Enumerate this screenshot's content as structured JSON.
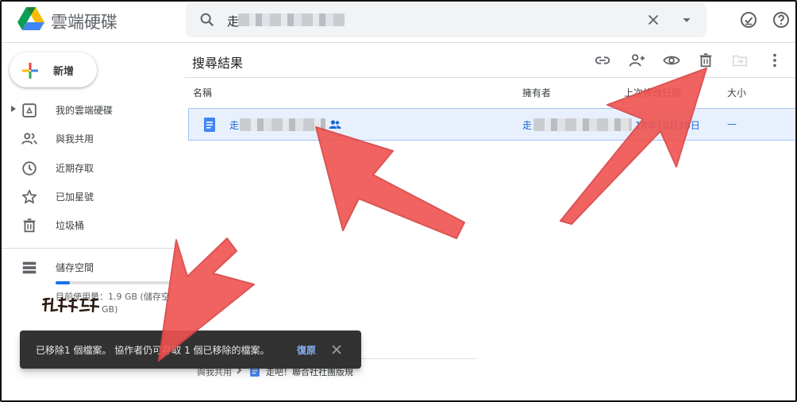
{
  "app": {
    "title": "雲端硬碟"
  },
  "search": {
    "query_visible": "走"
  },
  "new_button": {
    "label": "新增"
  },
  "sidebar": {
    "items": [
      {
        "label": "我的雲端硬碟",
        "icon": "my-drive-icon"
      },
      {
        "label": "與我共用",
        "icon": "shared-with-me-icon"
      },
      {
        "label": "近期存取",
        "icon": "recent-icon"
      },
      {
        "label": "已加星號",
        "icon": "star-icon"
      },
      {
        "label": "垃圾桶",
        "icon": "trash-icon"
      }
    ],
    "storage": {
      "label": "儲存空間",
      "usage_text": "目前使用量：1.9 GB (儲存空",
      "usage_text_line2": "GB)",
      "used_fraction": 0.12
    }
  },
  "main": {
    "title": "搜尋結果",
    "columns": {
      "name": "名稱",
      "owner": "擁有者",
      "modified": "上次修改日期",
      "size": "大小"
    },
    "rows": [
      {
        "name": "走",
        "owner": "走",
        "modified": "18年10月28日",
        "size": "—"
      }
    ],
    "location": {
      "root": "與我共用",
      "file": "走吧！聯合社社團版規"
    }
  },
  "toolbar": {
    "icons": [
      "link-icon",
      "share-icon",
      "preview-icon",
      "trash-icon",
      "move-icon",
      "more-icon"
    ]
  },
  "snackbar": {
    "message": "已移除1 個檔案。 協作者仍可存取 1 個已移除的檔案。",
    "action": "復原"
  },
  "colors": {
    "accent": "#1a73e8",
    "selected_row": "#e8f0fe",
    "annotation_arrow": "#ef5350",
    "snackbar": "#323232"
  }
}
